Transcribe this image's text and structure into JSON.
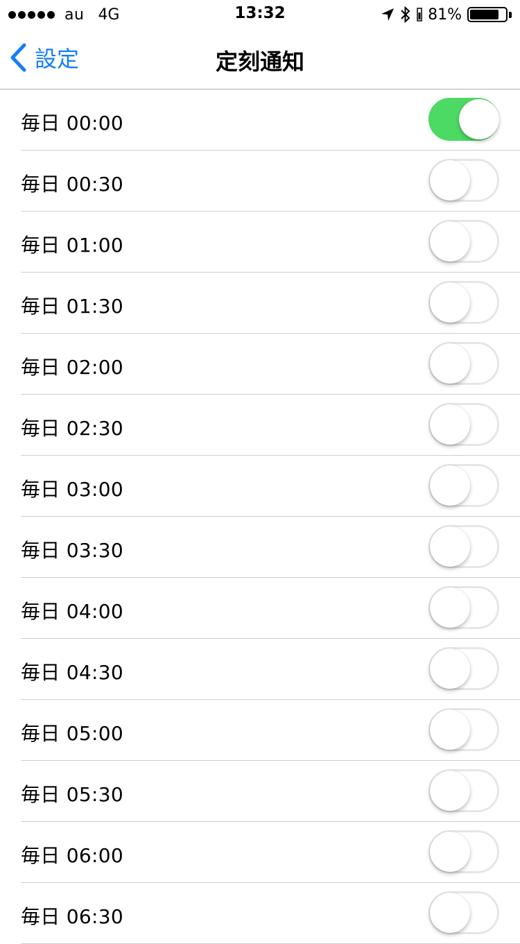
{
  "status_bar": {
    "carrier": "au",
    "network": "4G",
    "time": "13:32",
    "battery_percent": "81%",
    "battery_level": 0.81,
    "icons": [
      "location-arrow-icon",
      "bluetooth-icon",
      "battery-icon"
    ]
  },
  "nav": {
    "back_label": "設定",
    "title": "定刻通知"
  },
  "colors": {
    "accent": "#147efb",
    "toggle_on": "#4cd964"
  },
  "rows": [
    {
      "label": "毎日 00:00",
      "on": true
    },
    {
      "label": "毎日 00:30",
      "on": false
    },
    {
      "label": "毎日 01:00",
      "on": false
    },
    {
      "label": "毎日 01:30",
      "on": false
    },
    {
      "label": "毎日 02:00",
      "on": false
    },
    {
      "label": "毎日 02:30",
      "on": false
    },
    {
      "label": "毎日 03:00",
      "on": false
    },
    {
      "label": "毎日 03:30",
      "on": false
    },
    {
      "label": "毎日 04:00",
      "on": false
    },
    {
      "label": "毎日 04:30",
      "on": false
    },
    {
      "label": "毎日 05:00",
      "on": false
    },
    {
      "label": "毎日 05:30",
      "on": false
    },
    {
      "label": "毎日 06:00",
      "on": false
    },
    {
      "label": "毎日 06:30",
      "on": false
    }
  ]
}
